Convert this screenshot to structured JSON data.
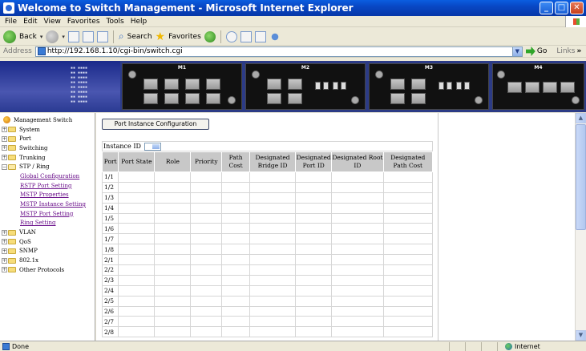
{
  "window": {
    "title": "Welcome to Switch Management - Microsoft Internet Explorer"
  },
  "menu": [
    "File",
    "Edit",
    "View",
    "Favorites",
    "Tools",
    "Help"
  ],
  "toolbar": {
    "back": "Back",
    "search": "Search",
    "favorites": "Favorites"
  },
  "address": {
    "label": "Address",
    "url": "http://192.168.1.10/cgi-bin/switch.cgi",
    "go": "Go",
    "links": "Links"
  },
  "banner": {
    "modules": [
      "M1",
      "M2",
      "M3",
      "M4"
    ]
  },
  "sidebar": {
    "root": "Management Switch",
    "items": [
      {
        "label": "System"
      },
      {
        "label": "Port"
      },
      {
        "label": "Switching"
      },
      {
        "label": "Trunking"
      },
      {
        "label": "STP / Ring"
      },
      {
        "label": "VLAN"
      },
      {
        "label": "QoS"
      },
      {
        "label": "SNMP"
      },
      {
        "label": "802.1x"
      },
      {
        "label": "Other Protocols"
      }
    ],
    "stp_children": [
      "Global Configuration",
      "RSTP Port Setting",
      "MSTP Properties",
      "MSTP Instance Setting",
      "MSTP Port Setting",
      "Ring Setting"
    ]
  },
  "main": {
    "button": "Port Instance Configuration",
    "instance_label": "Instance ID",
    "columns": [
      "Port",
      "Port State",
      "Role",
      "Priority",
      "Path Cost",
      "Designated Bridge ID",
      "Designated Port ID",
      "Designated Root ID",
      "Designated Path Cost"
    ],
    "ports": [
      "1/1",
      "1/2",
      "1/3",
      "1/4",
      "1/5",
      "1/6",
      "1/7",
      "1/8",
      "2/1",
      "2/2",
      "2/3",
      "2/4",
      "2/5",
      "2/6",
      "2/7",
      "2/8"
    ]
  },
  "status": {
    "left": "Done",
    "zone": "Internet"
  }
}
